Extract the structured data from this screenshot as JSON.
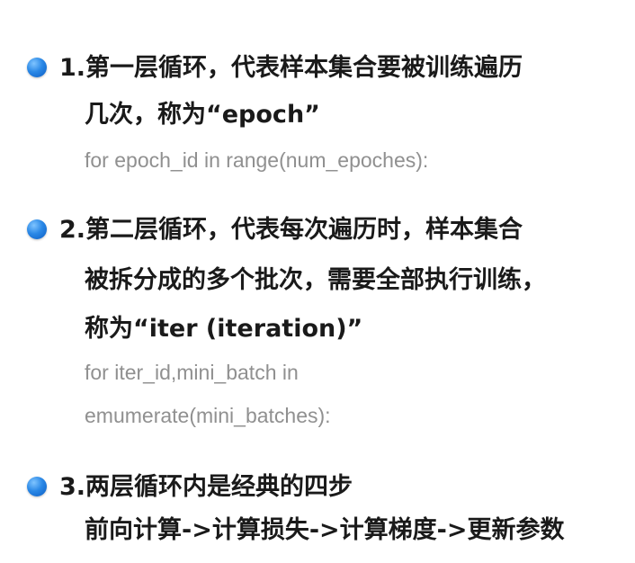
{
  "items": [
    {
      "title_lines": [
        "1.第一层循环，代表样本集合要被训练遍历",
        "几次，称为“epoch”"
      ],
      "code_lines": [
        "for epoch_id in range(num_epoches):"
      ]
    },
    {
      "title_lines": [
        "2.第二层循环，代表每次遍历时，样本集合",
        "被拆分成的多个批次，需要全部执行训练，",
        "称为“iter (iteration)”"
      ],
      "code_lines": [
        "for iter_id,mini_batch in",
        "emumerate(mini_batches):"
      ]
    },
    {
      "title_lines": [
        "3.两层循环内是经典的四步",
        "前向计算->计算损失->计算梯度->更新参数"
      ],
      "code_lines": []
    }
  ],
  "colors": {
    "bullet": "#2a88e6",
    "title_text": "#1a1a1a",
    "code_text": "#909090",
    "background": "#ffffff"
  },
  "icons": {
    "bullet": "blue-dot-bullet-icon"
  }
}
